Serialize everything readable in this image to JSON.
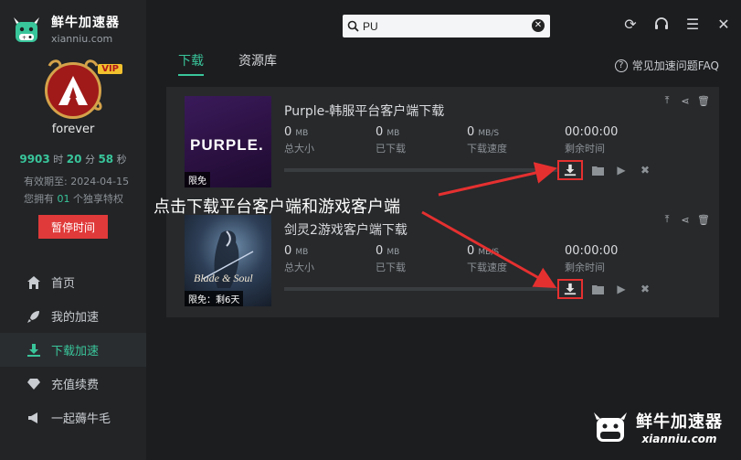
{
  "app": {
    "name_cn": "鲜牛加速器",
    "domain": "xianniu.com"
  },
  "user": {
    "name": "forever",
    "vip": "VIP",
    "time_hours": "9903",
    "time_h_unit": "时",
    "time_minutes": "20",
    "time_m_unit": "分",
    "time_seconds": "58",
    "time_s_unit": "秒",
    "expire": "有效期至: 2024-04-15",
    "priv_prefix": "您拥有",
    "priv_count": "01",
    "priv_suffix": "个独享特权",
    "pause_label": "暂停时间"
  },
  "nav": [
    {
      "label": "首页",
      "icon": "home-icon"
    },
    {
      "label": "我的加速",
      "icon": "rocket-icon"
    },
    {
      "label": "下载加速",
      "icon": "download-icon",
      "active": true
    },
    {
      "label": "充值续费",
      "icon": "diamond-icon"
    },
    {
      "label": "一起薅牛毛",
      "icon": "megaphone-icon"
    }
  ],
  "search": {
    "value": "PU"
  },
  "tabs": [
    {
      "label": "下载",
      "active": true
    },
    {
      "label": "资源库"
    }
  ],
  "faq": "常见加速问题FAQ",
  "downloads": [
    {
      "title": "Purple-韩服平台客户端下载",
      "thumb_text": "PURPLE.",
      "tag": "限免",
      "size": "0",
      "size_unit": "MB",
      "size_label": "总大小",
      "done": "0",
      "done_unit": "MB",
      "done_label": "已下载",
      "speed": "0",
      "speed_unit": "MB/S",
      "speed_label": "下载速度",
      "remaining": "00:00:00",
      "remaining_label": "剩余时间",
      "progress": 0
    },
    {
      "title": "剑灵2游戏客户端下载",
      "thumb_text": "Blade & Soul",
      "tag": "限免：剩6天",
      "size": "0",
      "size_unit": "MB",
      "size_label": "总大小",
      "done": "0",
      "done_unit": "MB",
      "done_label": "已下载",
      "speed": "0",
      "speed_unit": "MB/S",
      "speed_label": "下载速度",
      "remaining": "00:00:00",
      "remaining_label": "剩余时间",
      "progress": 0
    }
  ],
  "annotation": "点击下载平台客户端和游戏客户端",
  "watermark": {
    "cn": "鲜牛加速器",
    "en": "xianniu.com"
  },
  "colors": {
    "accent": "#39c59a",
    "danger": "#e03a3a",
    "arrow": "#e53030"
  }
}
